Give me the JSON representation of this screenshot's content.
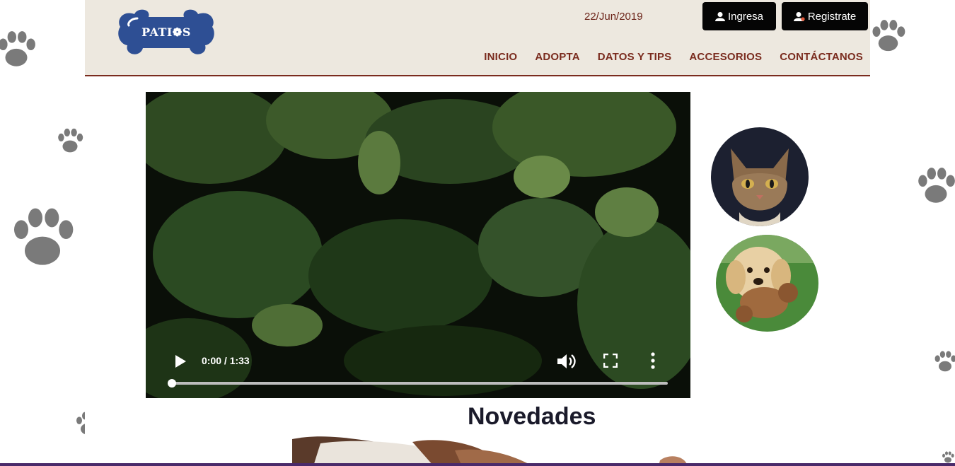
{
  "header": {
    "logo_text": "PATI❁S",
    "date": "22/Jun/2019",
    "login_label": "Ingresa",
    "register_label": "Registrate"
  },
  "nav": {
    "items": [
      {
        "label": "INICIO"
      },
      {
        "label": "ADOPTA"
      },
      {
        "label": "DATOS Y TIPS"
      },
      {
        "label": "ACCESORIOS"
      },
      {
        "label": "CONTÁCTANOS"
      }
    ]
  },
  "video": {
    "time": "0:00 / 1:33",
    "progress": 0
  },
  "main": {
    "section_title": "Novedades"
  },
  "colors": {
    "header_bg": "#ede8df",
    "nav_text": "#7a2b1e",
    "logo_blue": "#2e4f94",
    "button_bg": "#050505"
  },
  "icons": [
    "paw-print-icon",
    "user-icon",
    "user-add-icon",
    "play-icon",
    "volume-icon",
    "fullscreen-icon",
    "more-vertical-icon"
  ]
}
